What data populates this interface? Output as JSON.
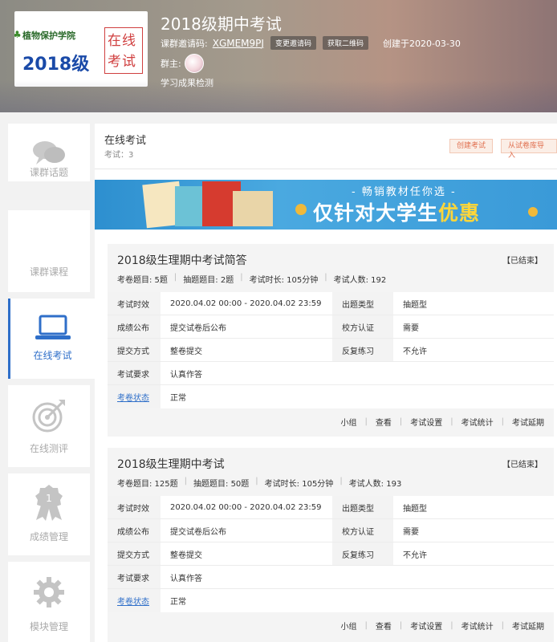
{
  "header": {
    "cover": {
      "school": "植物保护学院",
      "year": "2018级",
      "tag_line1": "在线",
      "tag_line2": "考试"
    },
    "title": "2018级期中考试",
    "invite_label": "课群邀请码:",
    "invite_code": "XGMEM9PJ",
    "change_code_btn": "变更邀请码",
    "qr_btn": "获取二维码",
    "created": "创建于2020-03-30",
    "owner_label": "群主:",
    "subtitle": "学习成果检测"
  },
  "sidebar": {
    "items": [
      {
        "label": "课群话题",
        "icon": "chat-bubbles-icon"
      },
      {
        "label": "课群课程",
        "icon": "course-icon"
      },
      {
        "label": "在线考试",
        "icon": "laptop-icon"
      },
      {
        "label": "在线测评",
        "icon": "target-icon"
      },
      {
        "label": "成绩管理",
        "icon": "award-medal-icon"
      },
      {
        "label": "模块管理",
        "icon": "gear-icon"
      }
    ]
  },
  "main": {
    "title": "在线考试",
    "count": "考试：3",
    "create_btn": "创建考试",
    "import_btn": "从试卷库导入",
    "banner": {
      "slogan": "- 畅销教材任你选 -",
      "headline_pre": "仅针对大学生",
      "headline_hl": "优惠"
    },
    "exams": [
      {
        "title": "2018级生理期中考试简答",
        "status": "【已结束】",
        "meta": [
          "考卷题目: 5题",
          "抽题题目: 2题",
          "考试时长: 105分钟",
          "考试人数: 192"
        ],
        "rows": {
          "time_k": "考试时效",
          "time_v": "2020.04.02 00:00 - 2020.04.02 23:59",
          "type_k": "出题类型",
          "type_v": "抽题型",
          "pub_k": "成绩公布",
          "pub_v": "提交试卷后公布",
          "auth_k": "校方认证",
          "auth_v": "需要",
          "submit_k": "提交方式",
          "submit_v": "整卷提交",
          "practice_k": "反复练习",
          "practice_v": "不允许",
          "req_k": "考试要求",
          "req_v": "认真作答",
          "paper_k": "考卷状态",
          "paper_v": "正常"
        },
        "actions": [
          "小组",
          "查看",
          "考试设置",
          "考试统计",
          "考试延期"
        ]
      },
      {
        "title": "2018级生理期中考试",
        "status": "【已结束】",
        "meta": [
          "考卷题目: 125题",
          "抽题题目: 50题",
          "考试时长: 105分钟",
          "考试人数: 193"
        ],
        "rows": {
          "time_k": "考试时效",
          "time_v": "2020.04.02 00:00 - 2020.04.02 23:59",
          "type_k": "出题类型",
          "type_v": "抽题型",
          "pub_k": "成绩公布",
          "pub_v": "提交试卷后公布",
          "auth_k": "校方认证",
          "auth_v": "需要",
          "submit_k": "提交方式",
          "submit_v": "整卷提交",
          "practice_k": "反复练习",
          "practice_v": "不允许",
          "req_k": "考试要求",
          "req_v": "认真作答",
          "paper_k": "考卷状态",
          "paper_v": "正常"
        },
        "actions": [
          "小组",
          "查看",
          "考试设置",
          "考试统计",
          "考试延期"
        ]
      }
    ]
  }
}
